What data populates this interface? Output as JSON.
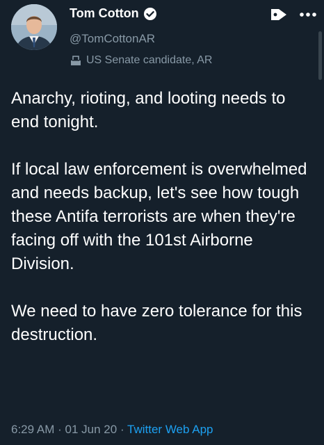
{
  "user": {
    "display_name": "Tom Cotton",
    "handle": "@TomCottonAR",
    "label": "US Senate candidate, AR"
  },
  "tweet": {
    "paragraphs": [
      "Anarchy, rioting, and looting needs to end tonight.",
      "If local law enforcement is overwhelmed and needs backup, let's see how tough these Antifa terrorists are when they're facing off with the 101st Airborne Division.",
      "We need to have zero tolerance for this destruction."
    ],
    "time": "6:29 AM",
    "date": "01 Jun 20",
    "source": "Twitter Web App",
    "separator": "·"
  },
  "icons": {
    "verified": "verified-badge-icon",
    "label": "ballot-box-icon",
    "tag": "tag-icon",
    "more": "more-dots-icon"
  },
  "colors": {
    "background": "#15202b",
    "text": "#ffffff",
    "secondary": "#8899a6",
    "accent": "#1da1f2"
  }
}
